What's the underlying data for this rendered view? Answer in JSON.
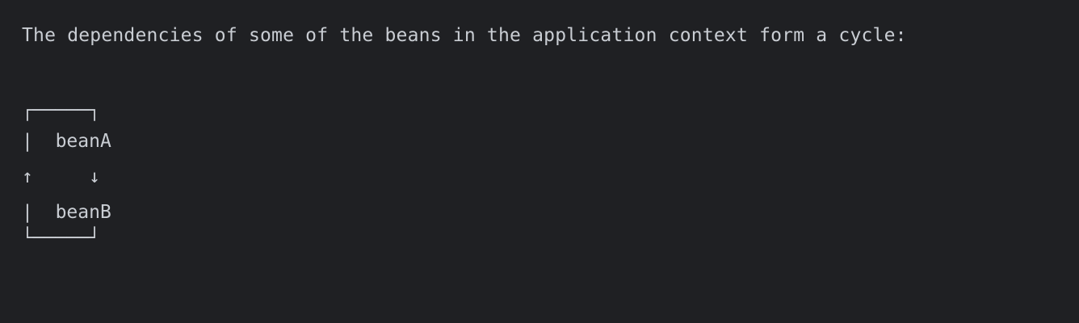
{
  "console": {
    "message": "The dependencies of some of the beans in the application context form a cycle:",
    "diagram": {
      "top_border": "┌─────┐",
      "left_bar": "|",
      "bean_a": "beanA",
      "arrow_up": "↑",
      "arrow_down": "↓",
      "bean_b": "beanB",
      "bottom_border": "└─────┘"
    }
  }
}
